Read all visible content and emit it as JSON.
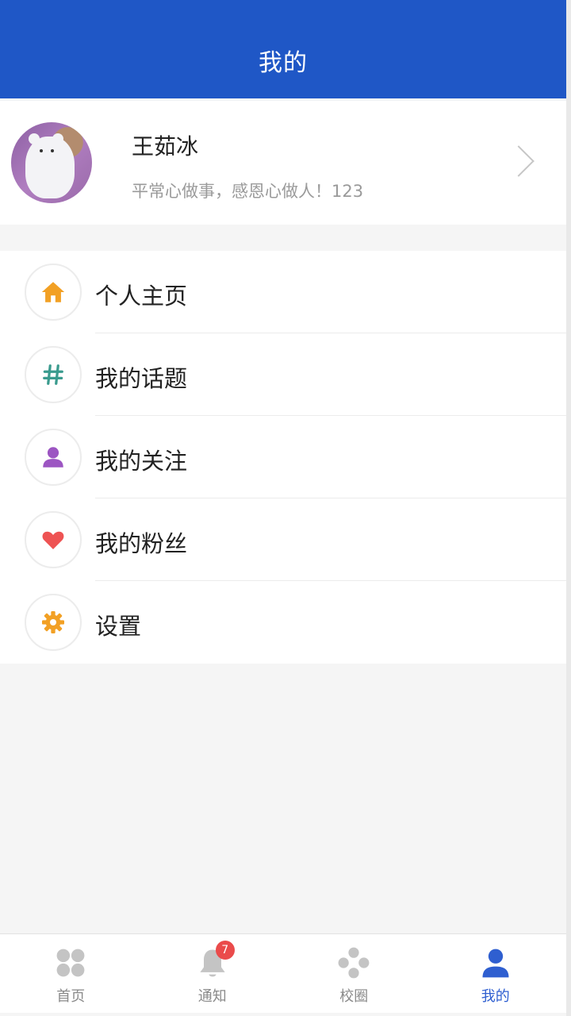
{
  "header": {
    "title": "我的"
  },
  "profile": {
    "name": "王茹冰",
    "bio": "平常心做事，感恩心做人！123"
  },
  "menu": {
    "items": [
      {
        "label": "个人主页",
        "icon": "home-icon",
        "color": "#f2a024"
      },
      {
        "label": "我的话题",
        "icon": "hashtag-icon",
        "color": "#3a9b8e"
      },
      {
        "label": "我的关注",
        "icon": "person-icon",
        "color": "#9c55c2"
      },
      {
        "label": "我的粉丝",
        "icon": "heart-icon",
        "color": "#ee5353"
      },
      {
        "label": "设置",
        "icon": "gear-icon",
        "color": "#f2a024"
      }
    ]
  },
  "tabbar": {
    "items": [
      {
        "label": "首页",
        "icon": "grid-icon",
        "active": false
      },
      {
        "label": "通知",
        "icon": "bell-icon",
        "active": false,
        "badge": "7"
      },
      {
        "label": "校圈",
        "icon": "circle-dots-icon",
        "active": false
      },
      {
        "label": "我的",
        "icon": "user-icon",
        "active": true
      }
    ]
  },
  "colors": {
    "primary": "#1f57c6",
    "active_tab": "#2f5fd0",
    "badge": "#ea4b4b"
  }
}
